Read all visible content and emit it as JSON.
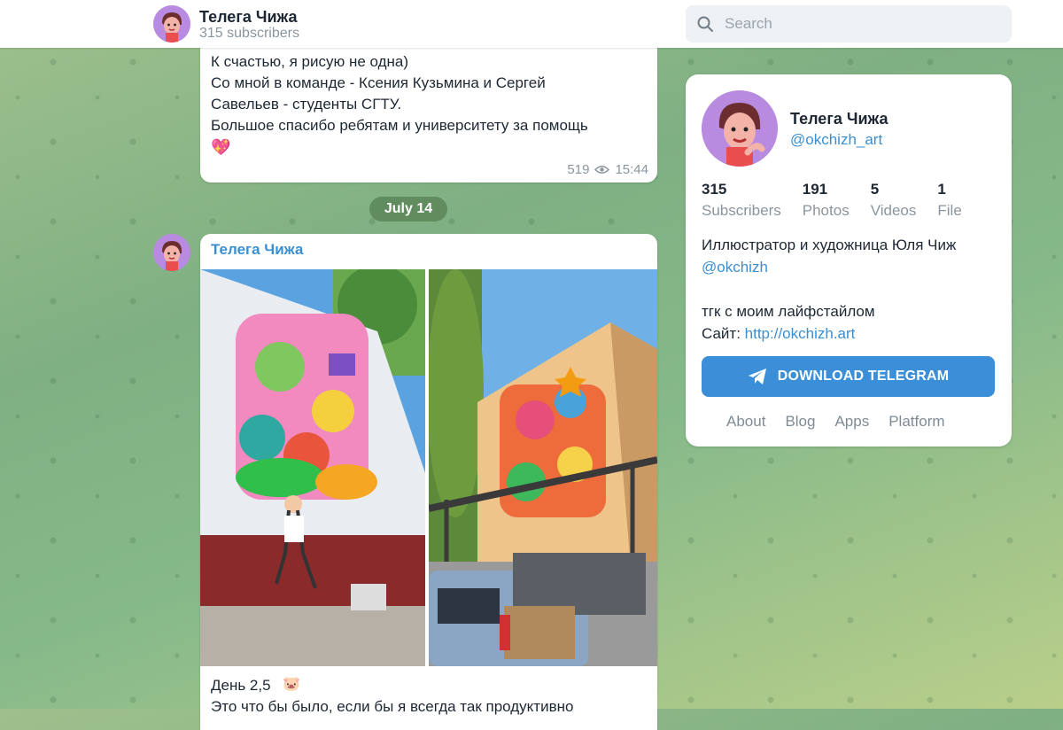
{
  "header": {
    "channel_title": "Телега Чижа",
    "channel_subtitle": "315 subscribers",
    "search_placeholder": "Search"
  },
  "messages": [
    {
      "text": "К счастью, я рисую не одна)\nСо мной в команде - Ксения Кузьмина и Сергей\nСавельев - студенты СГТУ.\nБольшое спасибо ребятам и университету за помощь",
      "emoji": "💖",
      "views": "519",
      "time": "15:44"
    },
    {
      "date": "July 14",
      "author": "Телега Чижа",
      "text": "День 2,5\nЭто что бы было, если бы я всегда так продуктивно",
      "emoji": "🐷"
    }
  ],
  "profile": {
    "name": "Телега Чижа",
    "handle": "@okchizh_art",
    "stats": [
      {
        "value": "315",
        "label": "Subscribers"
      },
      {
        "value": "191",
        "label": "Photos"
      },
      {
        "value": "5",
        "label": "Videos"
      },
      {
        "value": "1",
        "label": "File"
      }
    ],
    "bio_line1": "Иллюстратор и художница Юля Чиж",
    "bio_link": "@okchizh",
    "bio_line3": "тгк с моим лайфстайлом",
    "site_label": "Сайт: ",
    "site_url": "http://okchizh.art",
    "download_button": "DOWNLOAD TELEGRAM",
    "footer_links": [
      "About",
      "Blog",
      "Apps",
      "Platform"
    ]
  },
  "colors": {
    "accent": "#3a8fd8",
    "link": "#3a8fd0",
    "date_pill": "#5b8658"
  }
}
